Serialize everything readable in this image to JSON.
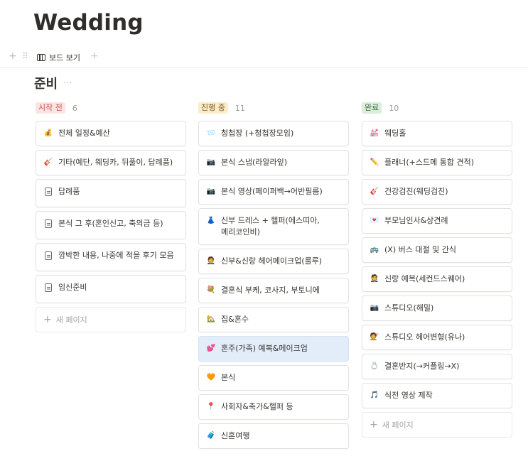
{
  "page": {
    "title": "Wedding"
  },
  "view_bar": {
    "tab_label": "보드 보기",
    "add_symbol": "+",
    "handle_symbol": "+"
  },
  "board": {
    "title": "준비",
    "more_symbol": "···"
  },
  "new_page_label": "새 페이지",
  "columns": [
    {
      "name": "시작 전",
      "count": "6",
      "tag_bg": "#fbe4e4",
      "tag_fg": "#c4554d",
      "cards": [
        {
          "emoji": "💰",
          "label": "전체 일정&예산"
        },
        {
          "emoji": "🎸",
          "label": "기타(예단, 웨딩카, 뒤풀이, 답례품)"
        },
        {
          "emoji": "doc",
          "label": "답례품"
        },
        {
          "emoji": "doc",
          "label": "본식 그 후(혼인신고, 축의금 등)"
        },
        {
          "emoji": "doc",
          "label": "깜박한 내용, 나중에 적을 후기 모음"
        },
        {
          "emoji": "doc",
          "label": "임신준비"
        }
      ]
    },
    {
      "name": "진행 중",
      "count": "11",
      "tag_bg": "#fdecc8",
      "tag_fg": "#7a5d2b",
      "cards": [
        {
          "emoji": "📨",
          "label": "청첩장 (+청첩장모임)"
        },
        {
          "emoji": "📷",
          "label": "본식 스냅(라알라잎)"
        },
        {
          "emoji": "📷",
          "label": "본식 영상(페이퍼백→어반필름)"
        },
        {
          "emoji": "👗",
          "label": "신부 드레스 + 헬퍼(에스띠아, 메리코인비)"
        },
        {
          "emoji": "🤵",
          "label": "신부&신랑 헤어메이크업(룰루)"
        },
        {
          "emoji": "💐",
          "label": "결혼식 부케, 코사지, 부토니에"
        },
        {
          "emoji": "🏡",
          "label": "집&혼수"
        },
        {
          "emoji": "💕",
          "label": "혼주(가족) 예복&메이크업",
          "highlight": true
        },
        {
          "emoji": "🧡",
          "label": "본식"
        },
        {
          "emoji": "📍",
          "label": "사회자&축가&헬퍼 등"
        },
        {
          "emoji": "🧳",
          "label": "신혼여행"
        }
      ]
    },
    {
      "name": "완료",
      "count": "10",
      "tag_bg": "#dbeddb",
      "tag_fg": "#3f6e4a",
      "cards": [
        {
          "emoji": "💒",
          "label": "웨딩홀"
        },
        {
          "emoji": "✏️",
          "label": "플래너(+스드메 통합 견적)"
        },
        {
          "emoji": "🎸",
          "label": "건강검진(웨딩검진)"
        },
        {
          "emoji": "💌",
          "label": "부모님인사&상견례"
        },
        {
          "emoji": "🚌",
          "label": "(X) 버스 대절 및 간식"
        },
        {
          "emoji": "🤵",
          "label": "신랑 예복(세컨드스퀘어)"
        },
        {
          "emoji": "📷",
          "label": "스튜디오(해밀)"
        },
        {
          "emoji": "💇",
          "label": "스튜디오 헤어변형(유나)"
        },
        {
          "emoji": "💍",
          "label": "결혼반지(→커플링→X)"
        },
        {
          "emoji": "🎵",
          "label": "식전 영상 제작"
        }
      ]
    }
  ]
}
